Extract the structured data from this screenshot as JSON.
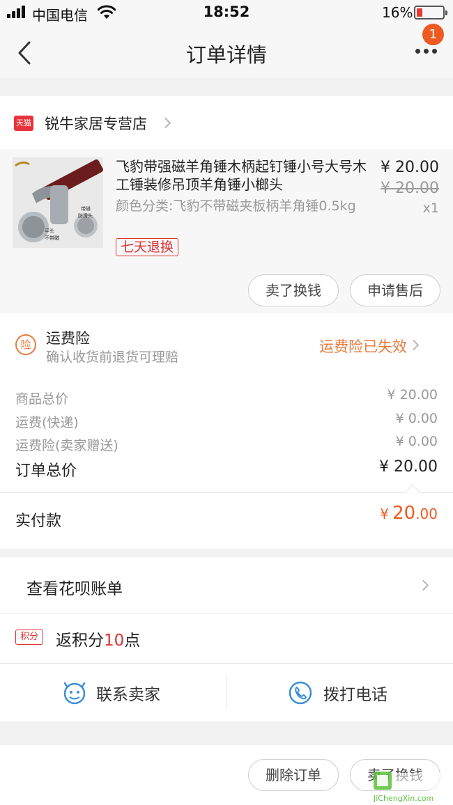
{
  "status_bar": {
    "carrier": "中国电信",
    "time": "18:52",
    "battery": "16%"
  },
  "nav": {
    "title": "订单详情",
    "badge_count": "1"
  },
  "store": {
    "platform_badge": "天猫",
    "name": "锐牛家居专营店"
  },
  "product": {
    "title": "飞豹带强磁羊角锤木柄起钉锤小号大号木工锤装修吊顶羊角锤小榔头",
    "spec": "颜色分类:飞豹不带磁夹板柄羊角锤0.5kg",
    "tag": "七天退换",
    "price": "¥ 20.00",
    "original_price": "¥ 20.00",
    "quantity": "x1",
    "image_labels": {
      "label_a": "带磁",
      "label_b": "防滑头",
      "label_c": "平头",
      "label_d": "不带磁"
    },
    "buttons": {
      "sell": "卖了换钱",
      "after_sale": "申请售后"
    }
  },
  "insurance": {
    "icon_text": "险",
    "title": "运费险",
    "subtitle": "确认收货前退货可理赔",
    "status": "运费险已失效"
  },
  "summary": {
    "rows": [
      {
        "label": "商品总价",
        "value": "¥ 20.00"
      },
      {
        "label": "运费(快递)",
        "value": "¥ 0.00"
      },
      {
        "label": "运费险(卖家赠送)",
        "value": "¥ 0.00"
      }
    ],
    "total_label": "订单总价",
    "total_value": "¥ 20.00",
    "paid_label": "实付款",
    "paid_currency": "¥",
    "paid_main": "20",
    "paid_decimal": ".00"
  },
  "huabei": {
    "label": "查看花呗账单"
  },
  "points": {
    "icon_text": "积分",
    "prefix": "返积分",
    "number": "10",
    "suffix": "点"
  },
  "contact": {
    "seller": "联系卖家",
    "phone": "拨打电话"
  },
  "bottom": {
    "delete": "删除订单",
    "sell": "卖了换钱"
  },
  "watermark": {
    "text": "JiChengXin.com"
  },
  "colors": {
    "accent_orange": "#f05a22",
    "insurance_orange": "#e97a3e",
    "tag_red": "#dd3333",
    "icon_blue": "#3a8fd6"
  }
}
